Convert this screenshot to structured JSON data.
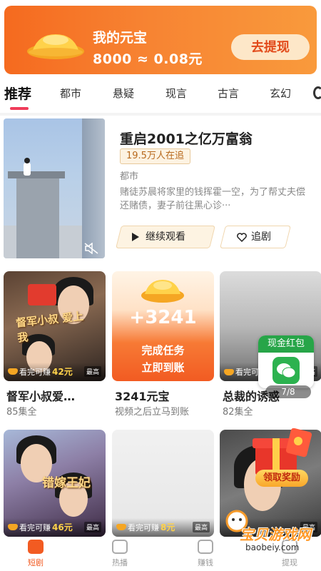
{
  "banner": {
    "title": "我的元宝",
    "rate": "8000 ≈ 0.08元",
    "button": "去提现"
  },
  "tabs": [
    {
      "label": "推荐",
      "active": true
    },
    {
      "label": "都市"
    },
    {
      "label": "悬疑"
    },
    {
      "label": "现言"
    },
    {
      "label": "古言"
    },
    {
      "label": "玄幻"
    }
  ],
  "featured": {
    "title": "重启2001之亿万富翁",
    "badge": "19.5万人在追",
    "genre": "都市",
    "description": "赌徒苏晨将家里的钱挥霍一空，为了帮丈夫偿还赌债，妻子前往黑心诊···",
    "watch_button": "继续观看",
    "follow_button": "追剧"
  },
  "cards": [
    {
      "title": "督军小叔爱…",
      "sub": "85集全",
      "earn_prefix": "看完可赚",
      "earn_amount": "42元",
      "tag": "最高",
      "poster_text": "督军小叔 爱上我"
    },
    {
      "title": "3241元宝",
      "sub": "视频之后立马到账",
      "task_plus": "+3241",
      "task_line1": "完成任务",
      "task_line2": "立即到账"
    },
    {
      "title": "总裁的诱惑",
      "sub": "82集全",
      "earn_prefix": "看完可",
      "tag": "最高"
    },
    {
      "earn_prefix": "看完可赚",
      "earn_amount": "46元",
      "tag": "最高",
      "poster_text": "错嫁王妃"
    },
    {
      "earn_prefix": "看完可赚",
      "earn_amount": "8元",
      "tag": "最高"
    },
    {
      "tag": "最高"
    }
  ],
  "red_packet": {
    "label": "现金红包",
    "count": "7/8"
  },
  "gift": {
    "button": "领取奖励"
  },
  "nav": [
    {
      "label": "短剧",
      "active": true
    },
    {
      "label": "热播"
    },
    {
      "label": "赚钱"
    },
    {
      "label": "提现"
    }
  ],
  "watermark": {
    "text": "宝贝游戏网",
    "url": "baobeiy.com"
  },
  "colors": {
    "accent": "#f25b22",
    "tab_underline": "#f03c5a",
    "badge_text": "#b86a1e",
    "wechat_green": "#2cb24f"
  }
}
